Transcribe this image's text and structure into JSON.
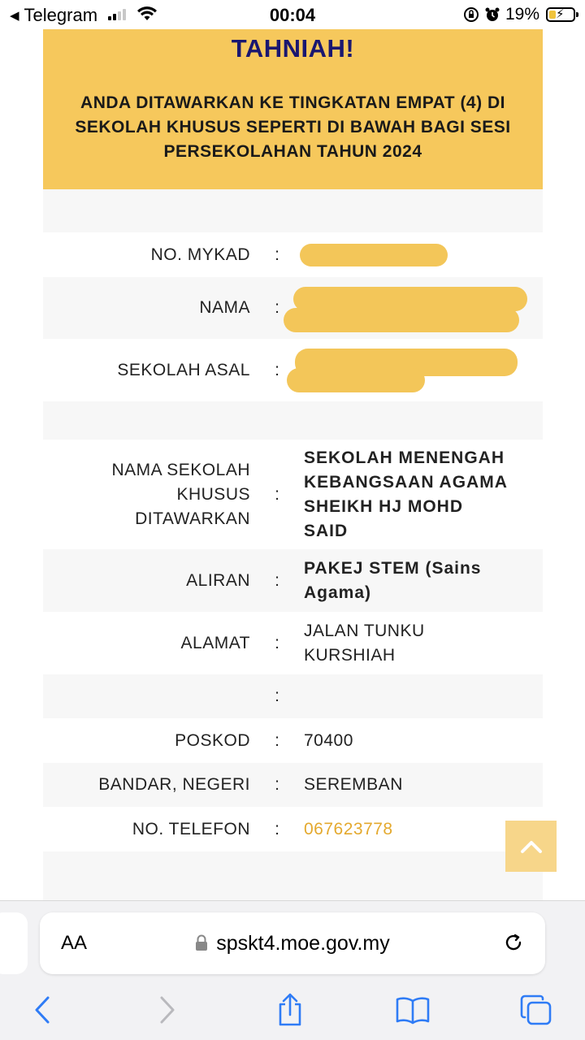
{
  "status_bar": {
    "back_app": "Telegram",
    "time": "00:04",
    "battery": "19%",
    "icons": [
      "back-arrow-icon",
      "signal-icon",
      "wifi-icon",
      "orientation-lock-icon",
      "alarm-icon",
      "battery-icon"
    ]
  },
  "banner": {
    "title": "TAHNIAH!",
    "message": "ANDA DITAWARKAN KE TINGKATAN EMPAT (4) DI SEKOLAH KHUSUS SEPERTI DI BAWAH BAGI SESI PERSEKOLAHAN TAHUN 2024",
    "background_color": "#f6c85c",
    "title_color": "#1a1770"
  },
  "fields": {
    "mykad": {
      "label": "NO. MYKAD",
      "colon": ":"
    },
    "nama": {
      "label": "NAMA",
      "colon": ":"
    },
    "sekolah_asal": {
      "label": "SEKOLAH ASAL",
      "colon": ":"
    },
    "sekolah_khusus": {
      "label_line1": "NAMA SEKOLAH",
      "label_line2": "KHUSUS",
      "label_line3": "DITAWARKAN",
      "colon": ":",
      "value_line1": "SEKOLAH MENENGAH",
      "value_line2": "KEBANGSAAN AGAMA",
      "value_line3": "SHEIKH HJ MOHD",
      "value_line4": "SAID"
    },
    "aliran": {
      "label": "ALIRAN",
      "colon": ":",
      "value_line1": "PAKEJ STEM (Sains",
      "value_line2": "Agama)"
    },
    "alamat": {
      "label": "ALAMAT",
      "colon": ":",
      "value_line1": "JALAN TUNKU",
      "value_line2": "KURSHIAH"
    },
    "alamat2": {
      "colon": ":"
    },
    "poskod": {
      "label": "POSKOD",
      "colon": ":",
      "value": "70400"
    },
    "bandar": {
      "label": "BANDAR, NEGERI",
      "colon": ":",
      "value": "SEREMBAN"
    },
    "telefon": {
      "label": "NO. TELEFON",
      "colon": ":",
      "value": "067623778"
    }
  },
  "colors": {
    "redaction": "#f3c659",
    "phone_link": "#e4a92e",
    "scroll_top_button": "#f7d68a"
  },
  "browser": {
    "text_size_label": "AA",
    "url": "spskt4.moe.gov.my",
    "icons": [
      "lock-icon",
      "reload-icon",
      "back-icon",
      "forward-icon",
      "share-icon",
      "bookmarks-icon",
      "tabs-icon"
    ]
  }
}
